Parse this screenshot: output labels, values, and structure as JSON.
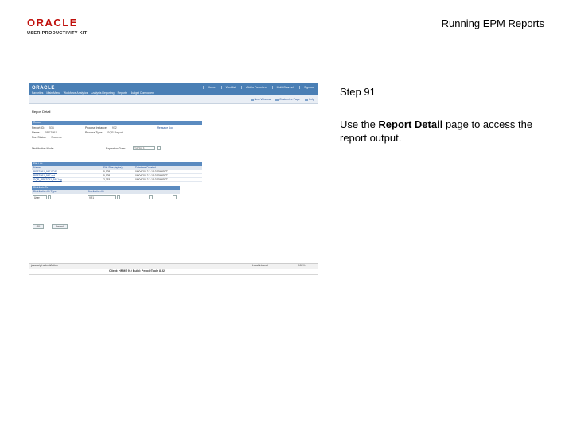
{
  "header": {
    "logo_brand": "ORACLE",
    "logo_product": "USER PRODUCTIVITY KIT",
    "title": "Running EPM Reports"
  },
  "step": {
    "title": "Step 91",
    "desc_prefix": "Use the ",
    "desc_bold": "Report Detail",
    "desc_suffix": " page to access the report output."
  },
  "screenshot": {
    "top_links": [
      "Home",
      "Worklist",
      "Add to Favorites",
      "Multi-Channel",
      "Sign out"
    ],
    "menu": [
      "Favorites",
      "Main Menu",
      "Workforce Analytics",
      "Analysis Reporting",
      "Reports",
      "Budget Component"
    ],
    "bar2_links": [
      "New Window",
      "Customize Page",
      "Help"
    ],
    "page_title": "Report Detail",
    "report_section": "Report",
    "fields": {
      "report_id_label": "Report ID:",
      "report_id_value": "536",
      "name_label": "Name:",
      "name_value": "BRFT051",
      "run_status_label": "Run Status:",
      "run_status_value": "Success",
      "process_instance_label": "Process Instance:",
      "process_instance_value": "972",
      "process_type_label": "Process Type:",
      "process_type_value": "SQR Report",
      "message_label": "Message Log",
      "distribution_label": "Distribution Node:",
      "expiration_label": "Expiration Date:",
      "expiration_value": "7/1/2013"
    },
    "file_list": {
      "header": "File List",
      "columns": [
        "Name",
        "File Size (bytes)",
        "Datetime Created"
      ],
      "rows": [
        [
          "BRFT051_567.PDF",
          "5,128",
          "06/04/2012 3:15:31PM PDT"
        ],
        [
          "BRFT051_567.out",
          "5,128",
          "06/04/2012 3:15:31PM PDT"
        ],
        [
          "SQR_BRFT051_567.log",
          "2,753",
          "06/04/2012 3:15:31PM PDT"
        ]
      ]
    },
    "distribute_to": {
      "header": "Distribute To",
      "columns": [
        "Distribution ID Type",
        "Distribution ID"
      ],
      "row": [
        "User",
        "VP1"
      ]
    },
    "buttons": [
      "OK",
      "Cancel"
    ],
    "status_left": "javascript:submitAction",
    "status_right": "Local intranet",
    "zoom": "100%",
    "caption": "Client: HRMS 9.0    Build: PeopleTools 8.52"
  },
  "colors": {
    "oracle_red": "#c0100c",
    "header_blue": "#4a7fb5",
    "grid_header_blue": "#5b8bc0",
    "link_blue": "#1f4e96"
  }
}
